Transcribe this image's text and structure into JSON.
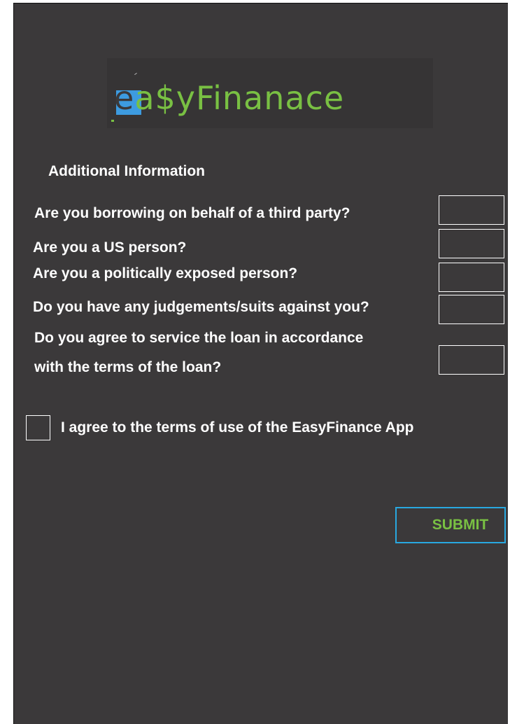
{
  "logo": {
    "text_first": "e",
    "text_rest": "a$yFinanace",
    "brand_green": "#79c043",
    "brand_blue": "#3d9be0"
  },
  "section": {
    "title": "Additional Information"
  },
  "questions": [
    {
      "text": "Are you borrowing on behalf of a third party?"
    },
    {
      "text": "Are you a US person?"
    },
    {
      "text": "Are you a politically exposed person?"
    },
    {
      "text": "Do you have any judgements/suits against you?"
    },
    {
      "text_line1": "Do you agree to service the loan in accordance",
      "text_line2": "with the terms of the loan?"
    }
  ],
  "agreement": {
    "label": "I agree to the terms of use of the EasyFinance App"
  },
  "submit": {
    "label": "SUBMIT",
    "border_color": "#29a8e0",
    "text_color": "#79c043"
  },
  "background_color": "#3b393a"
}
